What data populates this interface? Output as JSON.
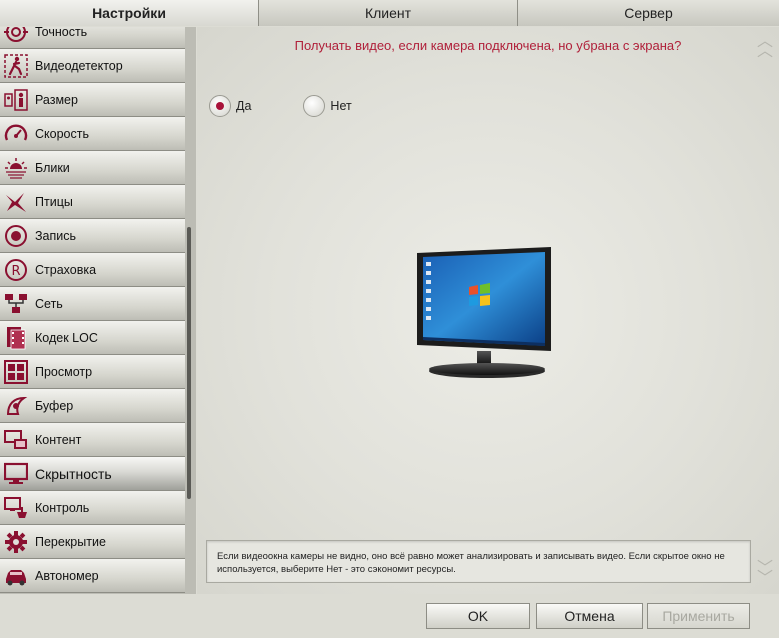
{
  "tabs": [
    "Настройки",
    "Клиент",
    "Сервер"
  ],
  "sidebar": {
    "items": [
      {
        "label": "Точность",
        "icon": "target-icon"
      },
      {
        "label": "Видеодетектор",
        "icon": "motion-person-icon"
      },
      {
        "label": "Размер",
        "icon": "size-icon"
      },
      {
        "label": "Скорость",
        "icon": "speedometer-icon"
      },
      {
        "label": "Блики",
        "icon": "glare-icon"
      },
      {
        "label": "Птицы",
        "icon": "bird-icon"
      },
      {
        "label": "Запись",
        "icon": "record-icon"
      },
      {
        "label": "Страховка",
        "icon": "registered-icon"
      },
      {
        "label": "Сеть",
        "icon": "network-icon"
      },
      {
        "label": "Кодек LOC",
        "icon": "film-codec-icon"
      },
      {
        "label": "Просмотр",
        "icon": "view-grid-icon"
      },
      {
        "label": "Буфер",
        "icon": "buffer-icon"
      },
      {
        "label": "Контент",
        "icon": "content-icon"
      },
      {
        "label": "Скрытность",
        "icon": "monitor-icon"
      },
      {
        "label": "Контроль",
        "icon": "control-icon"
      },
      {
        "label": "Перекрытие",
        "icon": "gear-icon"
      },
      {
        "label": "Автономер",
        "icon": "car-icon"
      }
    ],
    "selected_index": 13
  },
  "main": {
    "question": "Получать видео, если камера подключена, но убрана с экрана?",
    "options": [
      "Да",
      "Нет"
    ],
    "selected_option": "Да",
    "hint_line1": "Если видеоокна камеры не видно, оно всё равно может анализировать и записывать видео. Если скрытое окно не",
    "hint_line2": "используется, выберите Нет - это сэкономит ресурсы."
  },
  "buttons": {
    "ok": "OK",
    "cancel": "Отмена",
    "apply": "Применить"
  },
  "colors": {
    "accent": "#b0203a",
    "icon": "#8a1030"
  }
}
